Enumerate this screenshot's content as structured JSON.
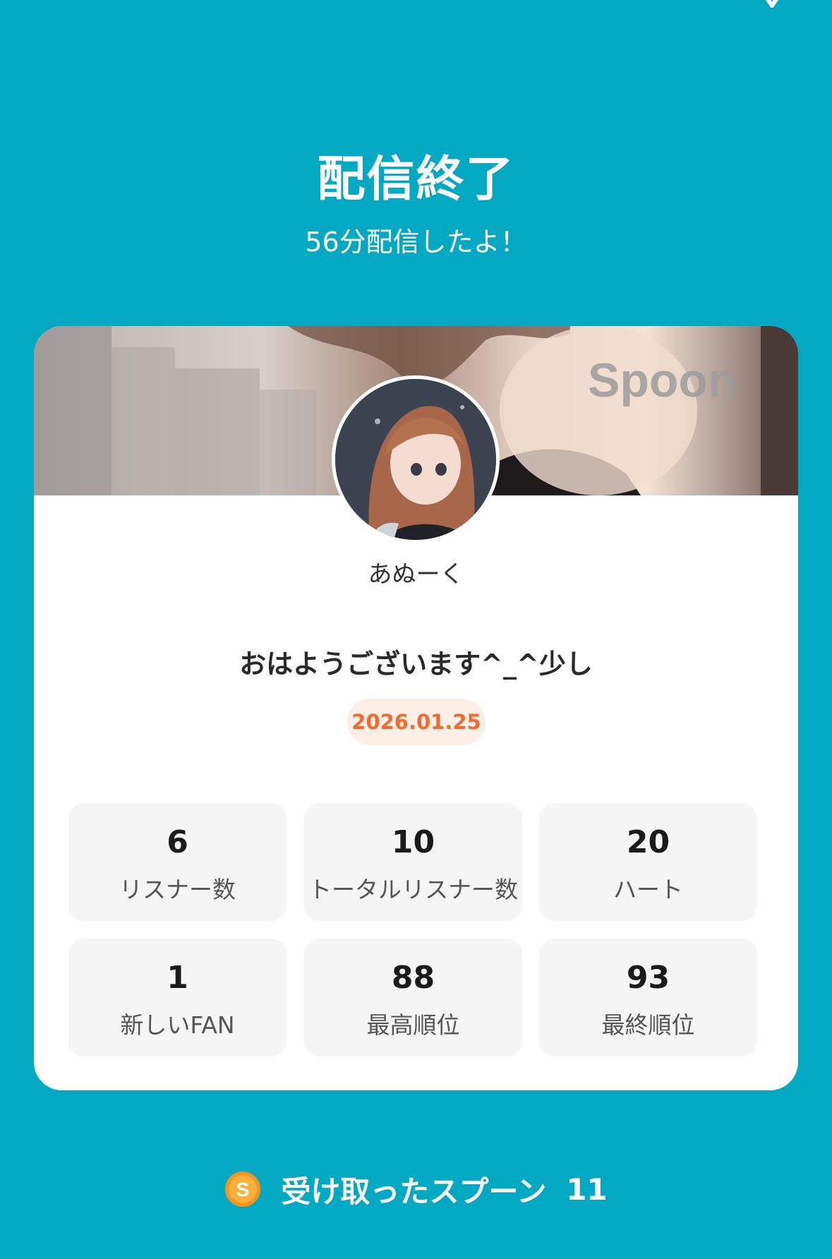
{
  "header": {
    "title": "配信終了",
    "subtitle": "56分配信したよ！"
  },
  "card": {
    "brand_watermark": "Spoon",
    "username": "あぬーく",
    "live_title": "おはようございます^_^少し",
    "date": "2026.01.25",
    "stats": [
      {
        "value": "6",
        "label": "リスナー数"
      },
      {
        "value": "10",
        "label": "トータルリスナー数"
      },
      {
        "value": "20",
        "label": "ハート"
      },
      {
        "value": "1",
        "label": "新しいFAN"
      },
      {
        "value": "88",
        "label": "最高順位"
      },
      {
        "value": "93",
        "label": "最終順位"
      }
    ]
  },
  "footer": {
    "coin_letter": "S",
    "received_label": "受け取ったスプーン",
    "received_count": "11"
  },
  "colors": {
    "background": "#03a9c3",
    "date_accent": "#f26a2e",
    "date_bg": "#fdeee6",
    "coin": "#f7941d"
  },
  "icons": {
    "close": "close-icon",
    "coin": "spoon-coin-icon"
  }
}
